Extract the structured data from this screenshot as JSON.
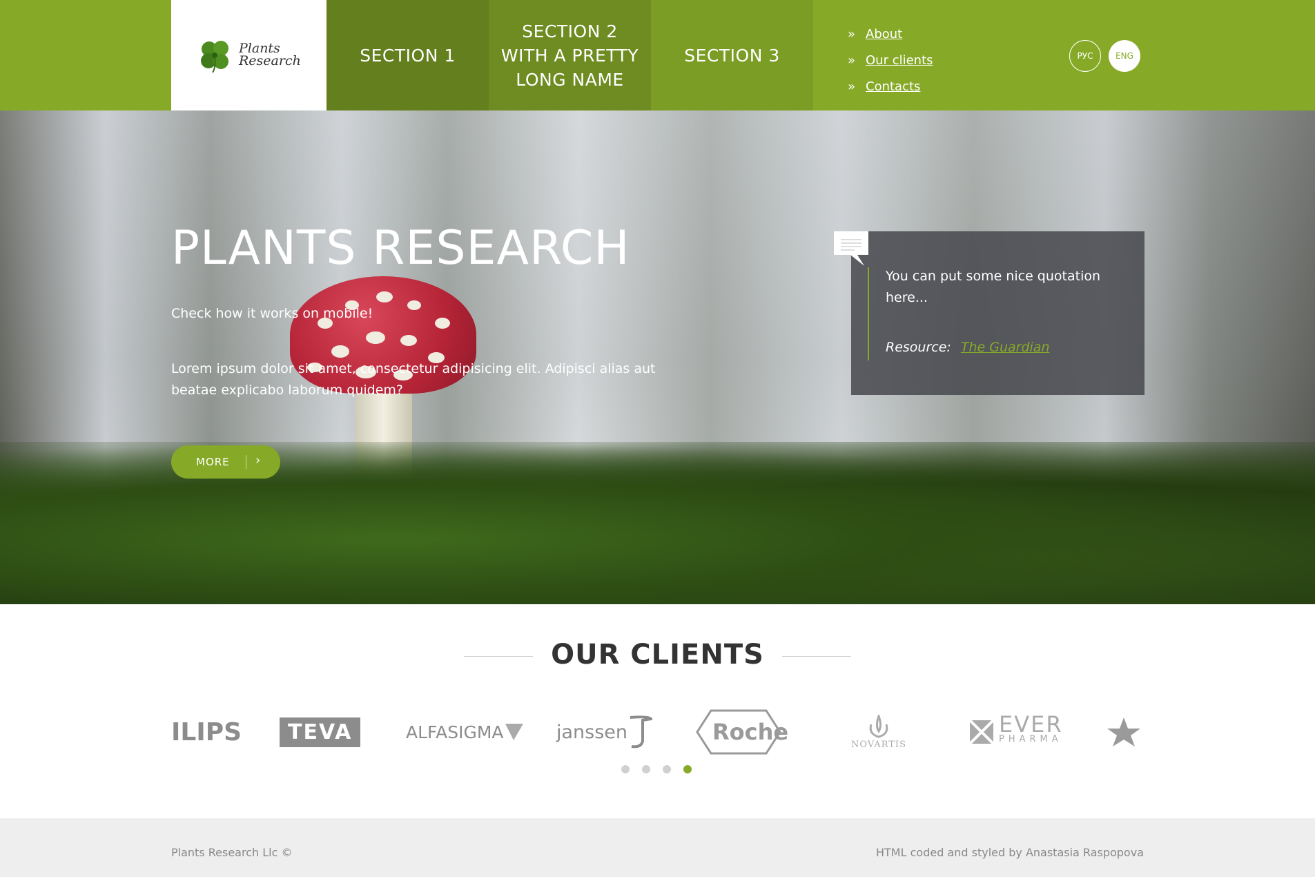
{
  "header": {
    "logo": {
      "line1": "Plants",
      "line2": "Research"
    },
    "nav": [
      {
        "label": "SECTION 1"
      },
      {
        "label": "SECTION 2 WITH A PRETTY LONG NAME"
      },
      {
        "label": "SECTION 3"
      }
    ],
    "sub_links": [
      {
        "bullet": "»",
        "label": "About"
      },
      {
        "bullet": "»",
        "label": "Our clients"
      },
      {
        "bullet": "»",
        "label": "Contacts"
      }
    ],
    "languages": [
      {
        "label": "РУС",
        "active": false
      },
      {
        "label": "ENG",
        "active": true
      }
    ]
  },
  "hero": {
    "title": "PLANTS RESEARCH",
    "subtitle": "Check how it works on mobile!",
    "body": "Lorem ipsum dolor sit amet, consectetur adipisicing elit. Adipisci alias aut beatae explicabo laborum quidem?",
    "more_label": "MORE",
    "more_arrow": "›",
    "quote": {
      "text": "You can put some nice quotation here...",
      "resource_label": "Resource:",
      "resource_link": "The Guardian"
    }
  },
  "clients": {
    "title": "OUR CLIENTS",
    "logos": [
      {
        "name": "philips",
        "text": "ILIPS"
      },
      {
        "name": "teva",
        "text": "TEVA"
      },
      {
        "name": "alfasigma",
        "text": "ALFASIGMA"
      },
      {
        "name": "janssen",
        "text": "janssen"
      },
      {
        "name": "roche",
        "text": "Roche"
      },
      {
        "name": "novartis",
        "text": "NOVARTIS"
      },
      {
        "name": "ever-pharma",
        "text": "EVER",
        "subtext": "PHARMA"
      },
      {
        "name": "star-logo",
        "text": ""
      }
    ],
    "pagination_total": 4,
    "pagination_active": 4
  },
  "footer": {
    "left": "Plants Research Llc ©",
    "right": "HTML coded and styled by Anastasia Raspopova"
  },
  "colors": {
    "accent": "#86aa27",
    "nav_dark": "#647f1e",
    "footer_bg": "#eeeeee"
  }
}
